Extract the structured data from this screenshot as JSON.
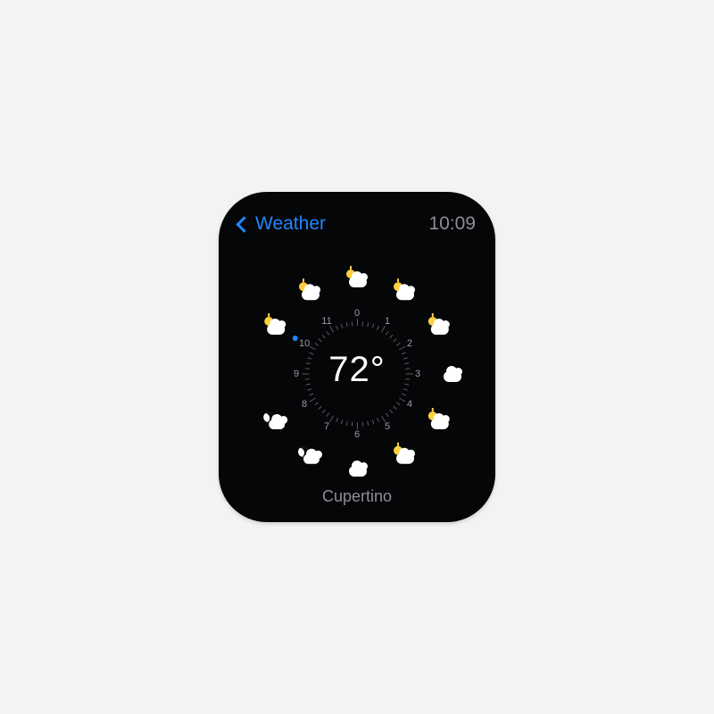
{
  "header": {
    "back_label": "Weather",
    "time": "10:09"
  },
  "current": {
    "temperature": "72°",
    "location": "Cupertino",
    "hour_index": 10
  },
  "colors": {
    "accent": "#1e87ff",
    "muted": "#8e8e93",
    "sun": "#ffcf3d"
  },
  "dial": {
    "hours": [
      "0",
      "1",
      "2",
      "3",
      "4",
      "5",
      "6",
      "7",
      "8",
      "9",
      "10",
      "11"
    ],
    "forecast": [
      {
        "hour": 0,
        "icon": "partly-cloudy-day"
      },
      {
        "hour": 1,
        "icon": "partly-cloudy-day"
      },
      {
        "hour": 2,
        "icon": "partly-cloudy-day"
      },
      {
        "hour": 3,
        "icon": "cloudy"
      },
      {
        "hour": 4,
        "icon": "partly-cloudy-day"
      },
      {
        "hour": 5,
        "icon": "partly-cloudy-day"
      },
      {
        "hour": 6,
        "icon": "cloudy"
      },
      {
        "hour": 7,
        "icon": "partly-cloudy-night"
      },
      {
        "hour": 8,
        "icon": "partly-cloudy-night"
      },
      {
        "hour": 9,
        "icon": ""
      },
      {
        "hour": 10,
        "icon": "partly-cloudy-day"
      },
      {
        "hour": 11,
        "icon": "partly-cloudy-day"
      }
    ]
  }
}
